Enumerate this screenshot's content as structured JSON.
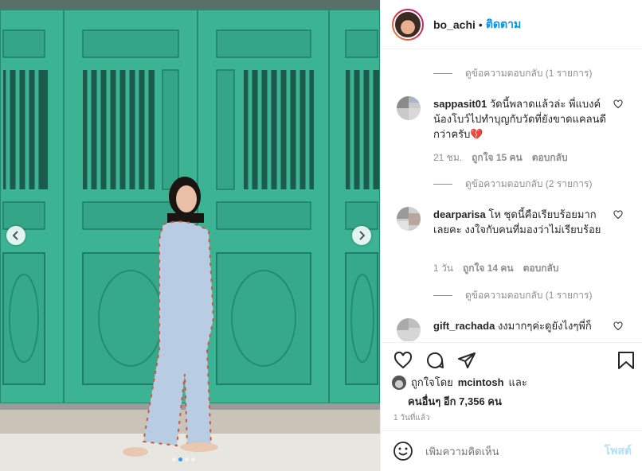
{
  "header": {
    "username": "bo_achi",
    "separator": "•",
    "follow_label": "ติดตาม"
  },
  "photo": {
    "carousel_dots": 4,
    "active_dot": 1
  },
  "comments": {
    "replies": [
      "ดูข้อความตอบกลับ (1 รายการ)",
      "ดูข้อความตอบกลับ (2 รายการ)",
      "ดูข้อความตอบกลับ (1 รายการ)"
    ],
    "items": [
      {
        "user": "sappasit01",
        "text": "วัดนี้พลาดแล้วล่ะ พี่แบงค์น้องโบว์ไปทำบุญกับวัดที่ยังขาดแคลนดีกว่าครับ",
        "emoji": "💔",
        "time": "21 ชม.",
        "likes": "ถูกใจ 15 คน",
        "reply": "ตอบกลับ"
      },
      {
        "user": "dearparisa",
        "text": "โห ชุดนี้คือเรียบร้อยมากเลยคะ งงใจกับคนที่มองว่าไม่เรียบร้อย",
        "time": "1 วัน",
        "likes": "ถูกใจ 14 คน",
        "reply": "ตอบกลับ"
      },
      {
        "user": "gift_rachada",
        "text": "งงมากๆค่ะดูยังไงๆพี่ก็"
      }
    ]
  },
  "likes": {
    "liked_by_prefix": "ถูกใจโดย",
    "liked_by_user": "mcintosh",
    "and": "และ",
    "others": "คนอื่นๆ อีก 7,356 คน"
  },
  "time_ago": "1 วันที่แล้ว",
  "add_comment": {
    "placeholder": "เพิ่มความคิดเห็น",
    "post_label": "โพสต์"
  },
  "colors": {
    "accent": "#0095f6",
    "post_disabled": "#b2dffc",
    "door_green": "#3aaa8c"
  }
}
